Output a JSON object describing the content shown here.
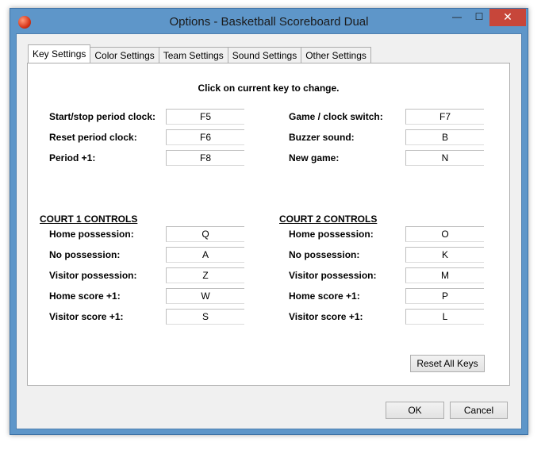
{
  "window": {
    "title": "Options - Basketball Scoreboard Dual",
    "min_glyph": "—",
    "max_glyph": "☐",
    "close_glyph": "✕"
  },
  "tabs": [
    {
      "label": "Key Settings",
      "active": true
    },
    {
      "label": "Color Settings",
      "active": false
    },
    {
      "label": "Team Settings",
      "active": false
    },
    {
      "label": "Sound Settings",
      "active": false
    },
    {
      "label": "Other Settings",
      "active": false
    }
  ],
  "instruction": "Click on current key to change.",
  "general": {
    "left": [
      {
        "label": "Start/stop period clock:",
        "key": "F5"
      },
      {
        "label": "Reset period clock:",
        "key": "F6"
      },
      {
        "label": "Period +1:",
        "key": "F8"
      }
    ],
    "right": [
      {
        "label": "Game / clock switch:",
        "key": "F7"
      },
      {
        "label": "Buzzer sound:",
        "key": "B"
      },
      {
        "label": "New game:",
        "key": "N"
      }
    ]
  },
  "court1": {
    "title": "COURT 1 CONTROLS",
    "rows": [
      {
        "label": "Home possession:",
        "key": "Q"
      },
      {
        "label": "No possession:",
        "key": "A"
      },
      {
        "label": "Visitor possession:",
        "key": "Z"
      },
      {
        "label": "Home score +1:",
        "key": "W"
      },
      {
        "label": "Visitor score +1:",
        "key": "S"
      }
    ]
  },
  "court2": {
    "title": "COURT 2 CONTROLS",
    "rows": [
      {
        "label": "Home possession:",
        "key": "O"
      },
      {
        "label": "No possession:",
        "key": "K"
      },
      {
        "label": "Visitor possession:",
        "key": "M"
      },
      {
        "label": "Home score +1:",
        "key": "P"
      },
      {
        "label": "Visitor score +1:",
        "key": "L"
      }
    ]
  },
  "buttons": {
    "reset": "Reset All Keys",
    "ok": "OK",
    "cancel": "Cancel"
  }
}
